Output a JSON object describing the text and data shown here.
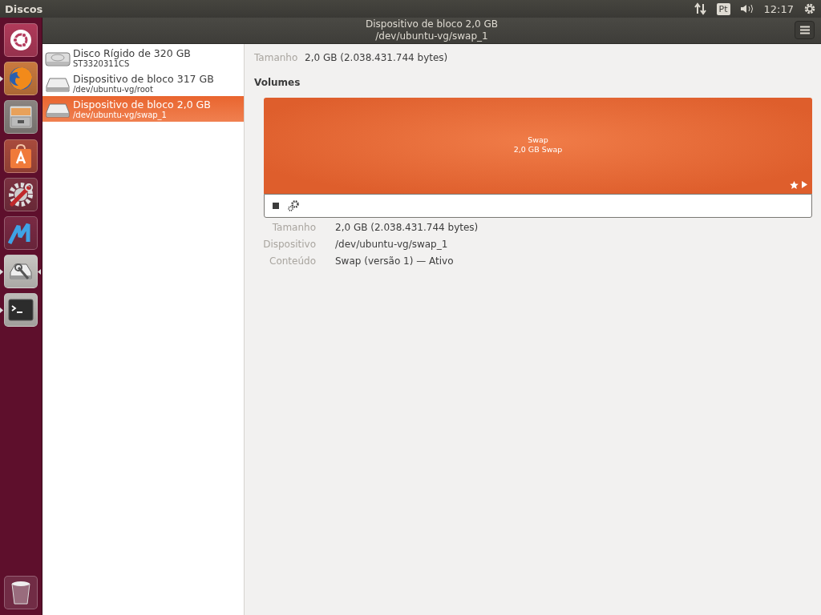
{
  "top_panel": {
    "app_name": "Discos",
    "keyboard_layout": "Pt",
    "clock": "12:17"
  },
  "launcher": {
    "items": [
      {
        "kind": "ubuntu",
        "running": false,
        "selected": false
      },
      {
        "kind": "browser",
        "running": true,
        "selected": false
      },
      {
        "kind": "files",
        "running": false,
        "selected": false
      },
      {
        "kind": "store",
        "running": false,
        "selected": false
      },
      {
        "kind": "settings",
        "running": false,
        "selected": false
      },
      {
        "kind": "zigzag",
        "running": false,
        "selected": false
      },
      {
        "kind": "disks",
        "running": true,
        "selected": true
      },
      {
        "kind": "terminal",
        "running": true,
        "selected": false
      }
    ]
  },
  "header": {
    "title": "Dispositivo de bloco 2,0 GB",
    "subtitle": "/dev/ubuntu-vg/swap_1"
  },
  "devices": [
    {
      "kind": "hdd",
      "name": "Disco Rígido de 320 GB",
      "detail": "ST3320311CS",
      "selected": false
    },
    {
      "kind": "block",
      "name": "Dispositivo de bloco 317 GB",
      "detail": "/dev/ubuntu-vg/root",
      "selected": false
    },
    {
      "kind": "block",
      "name": "Dispositivo de bloco 2,0 GB",
      "detail": "/dev/ubuntu-vg/swap_1",
      "selected": true
    }
  ],
  "summary": [
    {
      "label": "Tamanho",
      "value": "2,0 GB (2.038.431.744 bytes)"
    }
  ],
  "volumes": {
    "heading": "Volumes",
    "partitions": [
      {
        "name": "Swap",
        "description": "2,0 GB Swap",
        "selected": true
      }
    ]
  },
  "details": [
    {
      "label": "Tamanho",
      "value": "2,0 GB (2.038.431.744 bytes)"
    },
    {
      "label": "Dispositivo",
      "value": "/dev/ubuntu-vg/swap_1"
    },
    {
      "label": "Conteúdo",
      "value": "Swap (versão 1) — Ativo"
    }
  ]
}
